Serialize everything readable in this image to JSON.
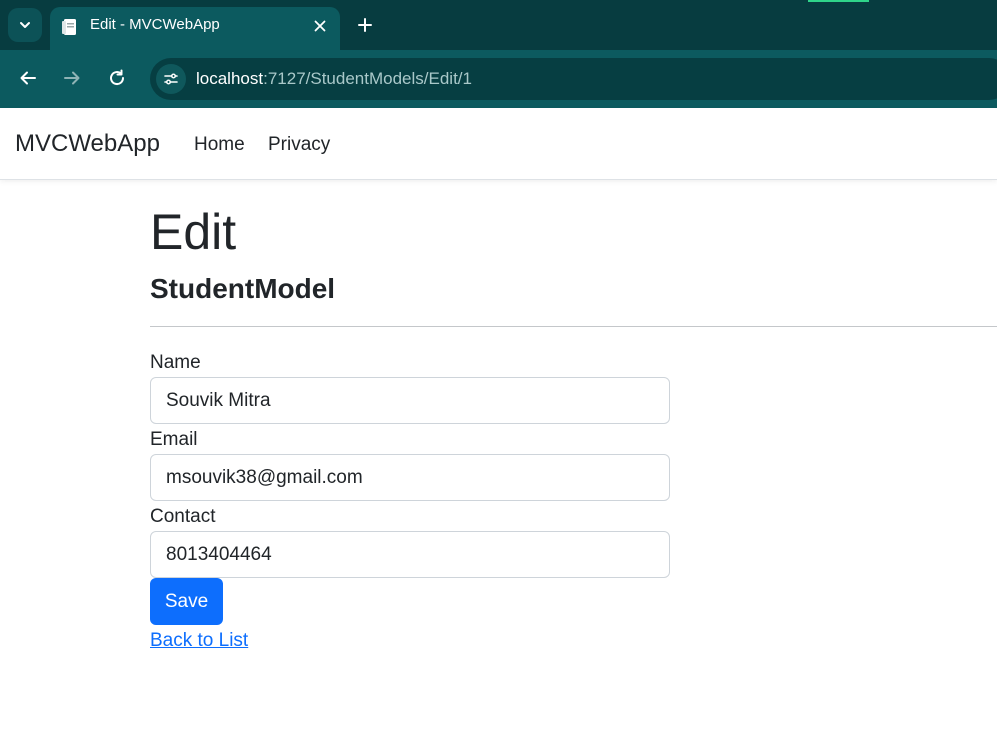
{
  "browser": {
    "tab_title": "Edit - MVCWebApp",
    "url_host": "localhost",
    "url_rest": ":7127/StudentModels/Edit/1"
  },
  "icons": {
    "tab_search": "chevron-down-icon",
    "favicon": "page-icon",
    "tab_close": "close-icon",
    "new_tab": "plus-icon",
    "back": "arrow-left-icon",
    "forward": "arrow-right-icon",
    "reload": "reload-icon",
    "site_info": "tune-icon"
  },
  "navbar": {
    "brand": "MVCWebApp",
    "links": [
      "Home",
      "Privacy"
    ]
  },
  "page": {
    "title": "Edit",
    "subtitle": "StudentModel"
  },
  "form": {
    "name_label": "Name",
    "name_value": "Souvik Mitra",
    "email_label": "Email",
    "email_value": "msouvik38@gmail.com",
    "contact_label": "Contact",
    "contact_value": "8013404464",
    "save_label": "Save",
    "back_label": "Back to List"
  },
  "colors": {
    "chrome_dark": "#073c40",
    "chrome_toolbar": "#0c5a5f",
    "primary": "#0d6efd",
    "text": "#212529"
  }
}
